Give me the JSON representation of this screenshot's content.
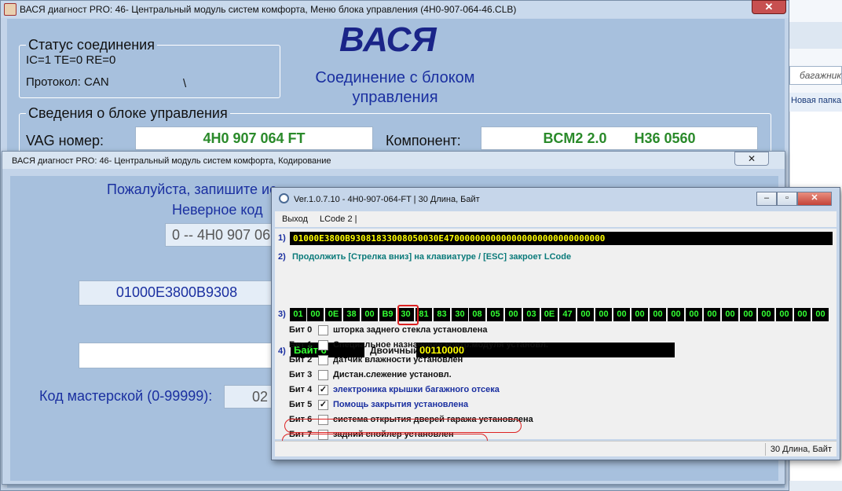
{
  "colors": {
    "window_bg": "#a7c0dd",
    "green_value": "#2a8a2a",
    "hex_yellow": "#ffff00",
    "hex_green": "#33ff33",
    "highlight_red": "#dd2222",
    "heading_blue": "#1a2fa0"
  },
  "background_window": {
    "search_placeholder": "багажник",
    "folder_label": "Новая папка"
  },
  "main_window": {
    "title": "ВАСЯ диагност PRO: 46- Центральный модуль систем комфорта,  Меню блока управления (4H0-907-064-46.CLB)",
    "close_label": "✕",
    "logo": "ВАСЯ",
    "subtitle_line1": "Соединение с блоком",
    "subtitle_line2": "управления",
    "connection_status": {
      "caption": "Статус соединения",
      "counters": "IC=1  TE=0   RE=0",
      "protocol": "Протокол: CAN",
      "spinner": "\\"
    },
    "unit_info": {
      "caption": "Сведения о блоке управления",
      "vag_label": "VAG номер:",
      "vag_value": "4H0 907 064 FT",
      "component_label": "Компонент:",
      "component_value": "BCM2 2.0       H36 0560"
    }
  },
  "coding_window": {
    "title": "ВАСЯ диагност PRO: 46- Центральный модуль систем комфорта,  Кодирование",
    "close_label": "✕",
    "prompt_line1": "Пожалуйста, запишите ис",
    "prompt_line2": "Неверное код",
    "part_number_field": "0 -- 4H0 907 06",
    "code_field": "01000E3800B9308",
    "workshop_label": "Код мастерской (0-99999):",
    "workshop_value": "02"
  },
  "lcode_window": {
    "title": "Ver.1.0.7.10 -   4H0-907-064-FT | 30 Длина, Байт",
    "menu": [
      "Выход",
      "LCode 2 |"
    ],
    "row1_label": "1)",
    "full_code": "01000E3800B93081833008050030E4700000000000000000000000000000",
    "row2_label": "2)",
    "hint": "Продолжить [Стрелка вниз] на клавиатуре / [ESC] закроет LCode",
    "row3_label": "3)",
    "bytes": [
      "01",
      "00",
      "0E",
      "38",
      "00",
      "B9",
      "30",
      "81",
      "83",
      "30",
      "08",
      "05",
      "00",
      "03",
      "0E",
      "47",
      "00",
      "00",
      "00",
      "00",
      "00",
      "00",
      "00",
      "00",
      "00",
      "00",
      "00",
      "00",
      "00",
      "00"
    ],
    "selected_byte_index": 6,
    "row4_label": "4)",
    "byte_label": "Байт 6",
    "binary_label": "Двоичный:",
    "binary_value": "00110000",
    "bits": [
      {
        "name": "Бит 0",
        "checked": false,
        "desc": "шторка заднего стекла установлена"
      },
      {
        "name": "Бит 1",
        "checked": false,
        "desc": "Специальное назначение контр.модуля установл."
      },
      {
        "name": "Бит 2",
        "checked": false,
        "desc": "датчик влажности установлен"
      },
      {
        "name": "Бит 3",
        "checked": false,
        "desc": "Дистан.слежение установл."
      },
      {
        "name": "Бит 4",
        "checked": true,
        "desc": "электроника крышки багажного отсека"
      },
      {
        "name": "Бит 5",
        "checked": true,
        "desc": "Помощь закрытия установлена"
      },
      {
        "name": "Бит 6",
        "checked": false,
        "desc": "система открытия дверей гаража установлена"
      },
      {
        "name": "Бит 7",
        "checked": false,
        "desc": "задний спойлер установлен"
      }
    ],
    "status_text": "30 Длина, Байт"
  }
}
